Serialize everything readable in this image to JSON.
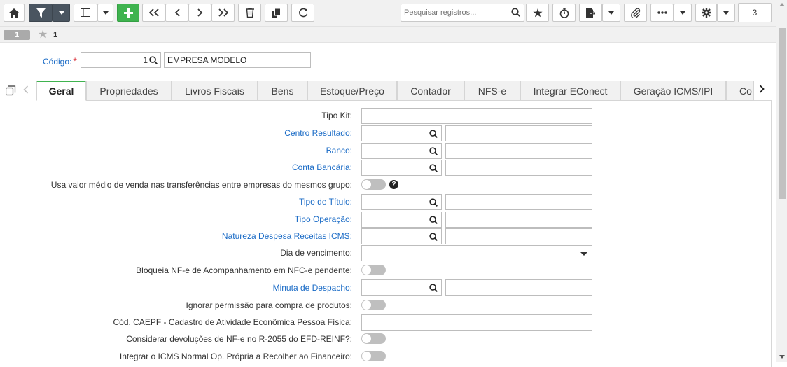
{
  "toolbar": {
    "search_placeholder": "Pesquisar registros...",
    "page_count": "3",
    "add_color": "#3fb34f",
    "filter_color": "#4a5560"
  },
  "record": {
    "badge": "1",
    "number": "1"
  },
  "code": {
    "label": "Código:",
    "required_mark": "*",
    "value": "1",
    "name_value": "EMPRESA MODELO"
  },
  "tabs": [
    {
      "label": "Geral",
      "active": true
    },
    {
      "label": "Propriedades"
    },
    {
      "label": "Livros Fiscais"
    },
    {
      "label": "Bens"
    },
    {
      "label": "Estoque/Preço"
    },
    {
      "label": "Contador"
    },
    {
      "label": "NFS-e"
    },
    {
      "label": "Integrar EConect"
    },
    {
      "label": "Geração ICMS/IPI"
    },
    {
      "label": "Co"
    }
  ],
  "form": {
    "tipo_kit": "Tipo Kit:",
    "centro_resultado": "Centro Resultado:",
    "banco": "Banco:",
    "conta_bancaria": "Conta Bancária:",
    "usa_valor_medio": "Usa valor médio de venda nas transferências entre empresas do mesmos grupo:",
    "tipo_titulo": "Tipo de Título:",
    "tipo_operacao": "Tipo Operação:",
    "natureza_despesa": "Natureza Despesa Receitas ICMS:",
    "dia_vencimento": "Dia de vencimento:",
    "bloqueia_nfe": "Bloqueia NF-e de Acompanhamento em NFC-e pendente:",
    "minuta_despacho": "Minuta de Despacho:",
    "ignorar_permissao": "Ignorar permissão para compra de produtos:",
    "cod_caepf": "Cód. CAEPF - Cadastro de Atividade Econômica Pessoa Física:",
    "considerar_devolucoes": "Considerar devoluções de NF-e no R-2055 do EFD-REINF?:",
    "integrar_icms": "Integrar o ICMS Normal Op. Própria a Recolher ao Financeiro:",
    "help_glyph": "?"
  }
}
